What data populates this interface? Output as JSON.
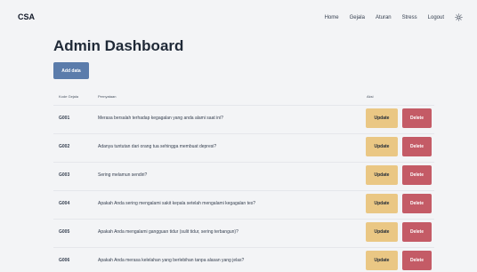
{
  "brand": "CSA",
  "nav": {
    "items": [
      "Home",
      "Gejala",
      "Aturan",
      "Stress",
      "Logout"
    ],
    "theme_icon": "sun-icon"
  },
  "page": {
    "title": "Admin Dashboard",
    "add_label": "Add data"
  },
  "table": {
    "headers": {
      "code": "Kode Gejala",
      "statement": "Pernyataan",
      "action": "Aksi"
    },
    "update_label": "Update",
    "delete_label": "Delete",
    "rows": [
      {
        "code": "G001",
        "statement": "Merasa bersalah terhadap kegagalan yang anda alami saat ini?"
      },
      {
        "code": "G002",
        "statement": "Adanya tuntutan dari orang tua sehingga membuat depresi?"
      },
      {
        "code": "G003",
        "statement": "Sering melamun sendiri?"
      },
      {
        "code": "G004",
        "statement": "Apakah Anda sering mengalami sakit kepala setelah mengalami kegagalan tes?"
      },
      {
        "code": "G005",
        "statement": "Apakah Anda mengalami gangguan tidur (sulit tidur, sering terbangun)?"
      },
      {
        "code": "G006",
        "statement": "Apakah Anda merasa kelelahan yang berlebihan tanpa alasan yang jelas?"
      }
    ]
  },
  "colors": {
    "primary": "#5b7cab",
    "update": "#eac784",
    "delete": "#c45b66",
    "background": "#f3f4f6"
  }
}
